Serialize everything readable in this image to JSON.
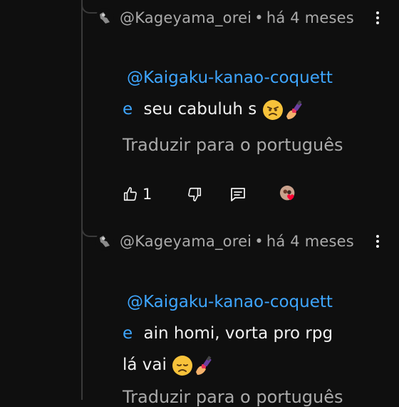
{
  "comments": [
    {
      "author": "@Kageyama_orei",
      "separator": "•",
      "time": "há 4 meses",
      "mention_line1": "@Kaigaku-kanao-coquett",
      "mention_line2": "e",
      "text_line1": "seu cabuluh s",
      "text_line2": "",
      "translate": "Traduzir para o português",
      "likes": "1"
    },
    {
      "author": "@Kageyama_orei",
      "separator": "•",
      "time": "há 4 meses",
      "mention_line1": "@Kaigaku-kanao-coquett",
      "mention_line2": "e",
      "text_line1": "ain homi, vorta pro rpg",
      "text_line2": "lá vai",
      "translate": "Traduzir para o português"
    }
  ],
  "icons": [
    "avatar-icon",
    "more-options-icon",
    "angry-face-emoji",
    "nail-polish-emoji",
    "disappointed-face-emoji",
    "thumbs-up-icon",
    "thumbs-down-icon",
    "reply-icon",
    "creator-heart-icon"
  ],
  "colors": {
    "background": "#0f0f0f",
    "mention": "#3ea6ff",
    "secondary_text": "#aaaaaa",
    "text": "#f1f1f1",
    "heart": "#ff0033"
  }
}
